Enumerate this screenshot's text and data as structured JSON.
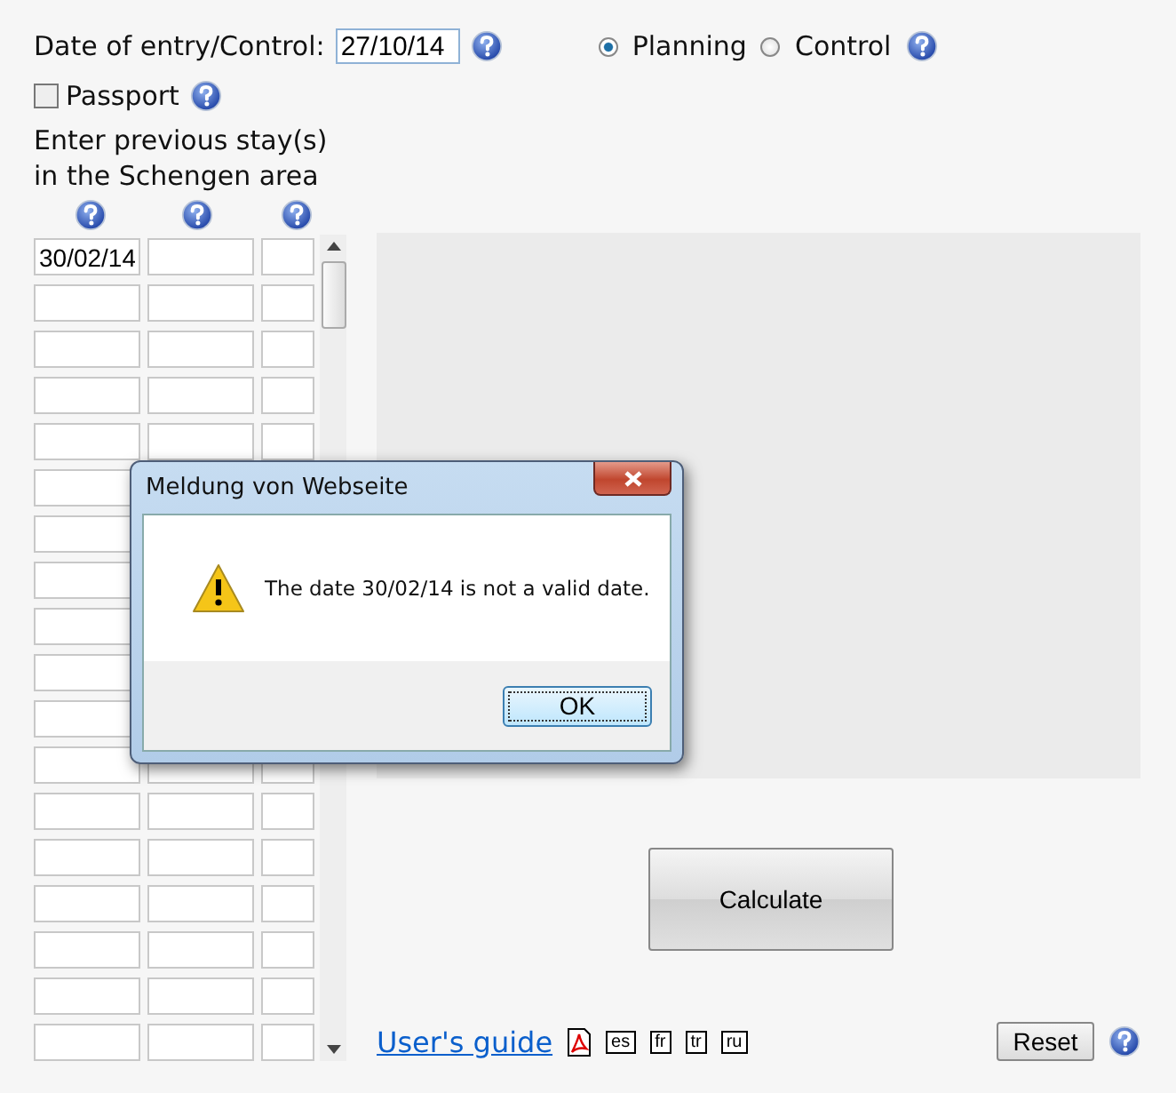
{
  "entry": {
    "label": "Date of entry/Control:",
    "value": "27/10/14"
  },
  "mode": [
    {
      "label": "Planning",
      "selected": true
    },
    {
      "label": "Control",
      "selected": false
    }
  ],
  "passport": {
    "label": "Passport",
    "checked": false
  },
  "stays_heading": "Enter previous stay(s) in the Schengen area",
  "stays": [
    {
      "column_1": "30/02/14"
    }
  ],
  "calculate": "Calculate",
  "guide": {
    "label": "User's guide",
    "languages": [
      "es",
      "fr",
      "tr",
      "ru"
    ]
  },
  "reset": "Reset",
  "dialog": {
    "title": "Meldung von Webseite",
    "message": "The date 30/02/14 is not a valid date.",
    "button": "OK"
  }
}
